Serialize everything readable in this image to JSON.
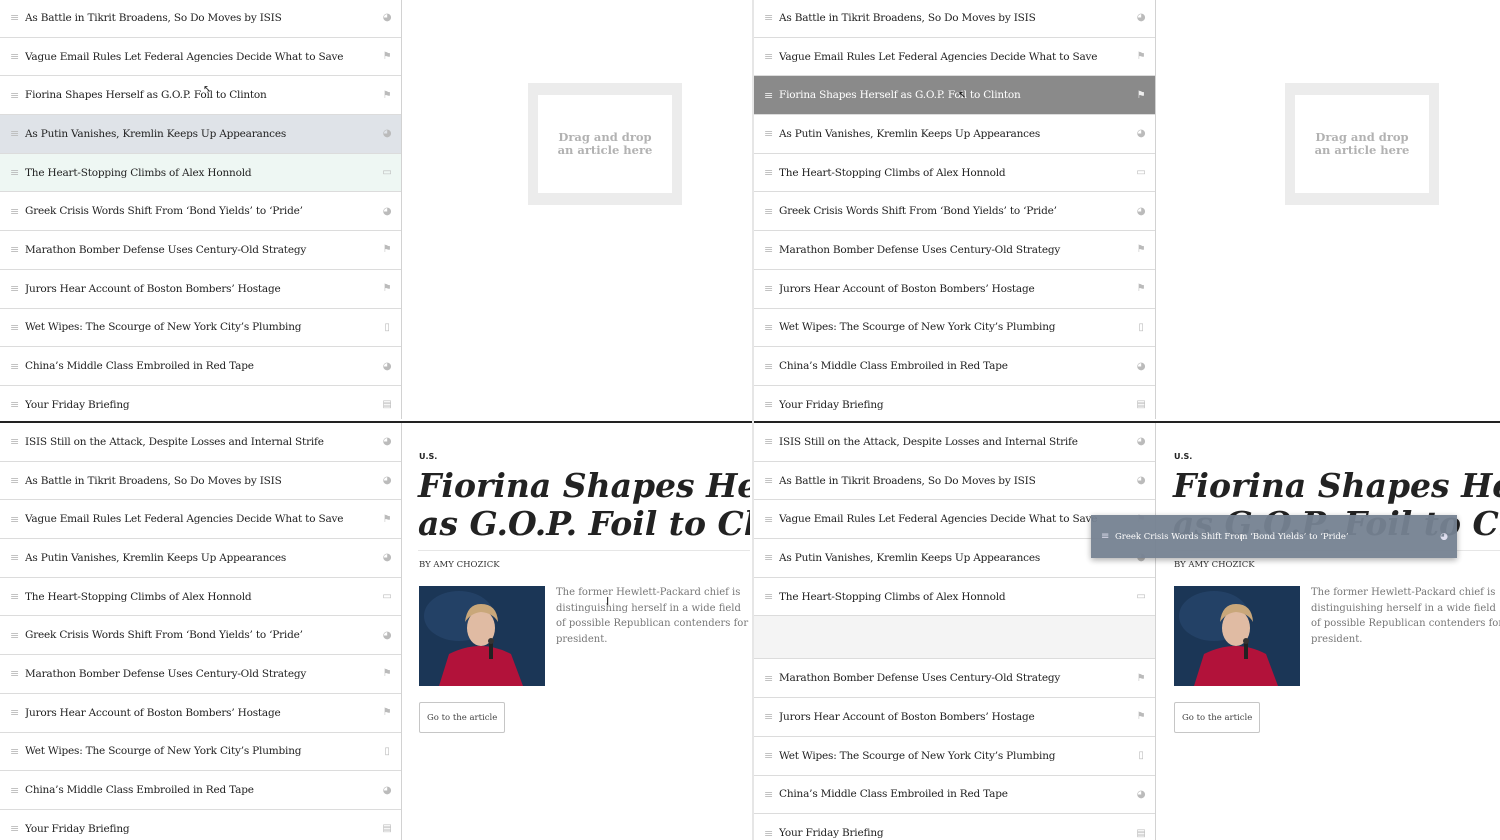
{
  "icons": {
    "grip": "≡",
    "world": "◕",
    "flag": "⚑",
    "photo": "▭",
    "phone": "▯",
    "calendar": "▤"
  },
  "panels": {
    "top_left": {
      "rows": [
        {
          "title": "As Battle in Tikrit Broadens, So Do Moves by ISIS",
          "icon": "world-icon",
          "glyph": "◕",
          "state": ""
        },
        {
          "title": "Vague Email Rules Let Federal Agencies Decide What to Save",
          "icon": "flag-icon",
          "glyph": "⚑",
          "state": ""
        },
        {
          "title": "Fiorina Shapes Herself as G.O.P. Foil to Clinton",
          "icon": "flag-icon",
          "glyph": "⚑",
          "state": ""
        },
        {
          "title": "As Putin Vanishes, Kremlin Keeps Up Appearances",
          "icon": "world-icon",
          "glyph": "◕",
          "state": "grey"
        },
        {
          "title": "The Heart-Stopping Climbs of Alex Honnold",
          "icon": "photo-icon",
          "glyph": "▭",
          "state": "mint"
        },
        {
          "title": "Greek Crisis Words Shift From ‘Bond Yields’ to ‘Pride’",
          "icon": "world-icon",
          "glyph": "◕",
          "state": ""
        },
        {
          "title": "Marathon Bomber Defense Uses Century-Old Strategy",
          "icon": "flag-icon",
          "glyph": "⚑",
          "state": ""
        },
        {
          "title": "Jurors Hear Account of Boston Bombers’ Hostage",
          "icon": "flag-icon",
          "glyph": "⚑",
          "state": ""
        },
        {
          "title": "Wet Wipes: The Scourge of New York City’s Plumbing",
          "icon": "phone-icon",
          "glyph": "▯",
          "state": ""
        },
        {
          "title": "China’s Middle Class Embroiled in Red Tape",
          "icon": "world-icon",
          "glyph": "◕",
          "state": ""
        },
        {
          "title": "Your Friday Briefing",
          "icon": "calendar-icon",
          "glyph": "▤",
          "state": ""
        }
      ],
      "dropzone": "Drag and drop an article here"
    },
    "top_right": {
      "rows": [
        {
          "title": "As Battle in Tikrit Broadens, So Do Moves by ISIS",
          "icon": "world-icon",
          "glyph": "◕",
          "state": ""
        },
        {
          "title": "Vague Email Rules Let Federal Agencies Decide What to Save",
          "icon": "flag-icon",
          "glyph": "⚑",
          "state": ""
        },
        {
          "title": "Fiorina Shapes Herself as G.O.P. Foil to Clinton",
          "icon": "flag-icon",
          "glyph": "⚑",
          "state": "dark"
        },
        {
          "title": "As Putin Vanishes, Kremlin Keeps Up Appearances",
          "icon": "world-icon",
          "glyph": "◕",
          "state": ""
        },
        {
          "title": "The Heart-Stopping Climbs of Alex Honnold",
          "icon": "photo-icon",
          "glyph": "▭",
          "state": ""
        },
        {
          "title": "Greek Crisis Words Shift From ‘Bond Yields’ to ‘Pride’",
          "icon": "world-icon",
          "glyph": "◕",
          "state": ""
        },
        {
          "title": "Marathon Bomber Defense Uses Century-Old Strategy",
          "icon": "flag-icon",
          "glyph": "⚑",
          "state": ""
        },
        {
          "title": "Jurors Hear Account of Boston Bombers’ Hostage",
          "icon": "flag-icon",
          "glyph": "⚑",
          "state": ""
        },
        {
          "title": "Wet Wipes: The Scourge of New York City’s Plumbing",
          "icon": "phone-icon",
          "glyph": "▯",
          "state": ""
        },
        {
          "title": "China’s Middle Class Embroiled in Red Tape",
          "icon": "world-icon",
          "glyph": "◕",
          "state": ""
        },
        {
          "title": "Your Friday Briefing",
          "icon": "calendar-icon",
          "glyph": "▤",
          "state": ""
        }
      ],
      "dropzone": "Drag and drop an article here"
    },
    "bottom_left": {
      "rows": [
        {
          "title": "ISIS Still on the Attack, Despite Losses and Internal Strife",
          "icon": "world-icon",
          "glyph": "◕",
          "state": ""
        },
        {
          "title": "As Battle in Tikrit Broadens, So Do Moves by ISIS",
          "icon": "world-icon",
          "glyph": "◕",
          "state": ""
        },
        {
          "title": "Vague Email Rules Let Federal Agencies Decide What to Save",
          "icon": "flag-icon",
          "glyph": "⚑",
          "state": ""
        },
        {
          "title": "As Putin Vanishes, Kremlin Keeps Up Appearances",
          "icon": "world-icon",
          "glyph": "◕",
          "state": ""
        },
        {
          "title": "The Heart-Stopping Climbs of Alex Honnold",
          "icon": "photo-icon",
          "glyph": "▭",
          "state": ""
        },
        {
          "title": "Greek Crisis Words Shift From ‘Bond Yields’ to ‘Pride’",
          "icon": "world-icon",
          "glyph": "◕",
          "state": ""
        },
        {
          "title": "Marathon Bomber Defense Uses Century-Old Strategy",
          "icon": "flag-icon",
          "glyph": "⚑",
          "state": ""
        },
        {
          "title": "Jurors Hear Account of Boston Bombers’ Hostage",
          "icon": "flag-icon",
          "glyph": "⚑",
          "state": ""
        },
        {
          "title": "Wet Wipes: The Scourge of New York City’s Plumbing",
          "icon": "phone-icon",
          "glyph": "▯",
          "state": ""
        },
        {
          "title": "China’s Middle Class Embroiled in Red Tape",
          "icon": "world-icon",
          "glyph": "◕",
          "state": ""
        },
        {
          "title": "Your Friday Briefing",
          "icon": "calendar-icon",
          "glyph": "▤",
          "state": ""
        }
      ]
    },
    "bottom_right": {
      "rows": [
        {
          "title": "ISIS Still on the Attack, Despite Losses and Internal Strife",
          "icon": "world-icon",
          "glyph": "◕",
          "state": ""
        },
        {
          "title": "As Battle in Tikrit Broadens, So Do Moves by ISIS",
          "icon": "world-icon",
          "glyph": "◕",
          "state": ""
        },
        {
          "title": "Vague Email Rules Let Federal Agencies Decide What to Save",
          "icon": "flag-icon",
          "glyph": "⚑",
          "state": ""
        },
        {
          "title": "As Putin Vanishes, Kremlin Keeps Up Appearances",
          "icon": "world-icon",
          "glyph": "◕",
          "state": ""
        },
        {
          "title": "The Heart-Stopping Climbs of Alex Honnold",
          "icon": "photo-icon",
          "glyph": "▭",
          "state": ""
        },
        {
          "title": "",
          "icon": "",
          "glyph": "",
          "state": "placeholder"
        },
        {
          "title": "Marathon Bomber Defense Uses Century-Old Strategy",
          "icon": "flag-icon",
          "glyph": "⚑",
          "state": ""
        },
        {
          "title": "Jurors Hear Account of Boston Bombers’ Hostage",
          "icon": "flag-icon",
          "glyph": "⚑",
          "state": ""
        },
        {
          "title": "Wet Wipes: The Scourge of New York City’s Plumbing",
          "icon": "phone-icon",
          "glyph": "▯",
          "state": ""
        },
        {
          "title": "China’s Middle Class Embroiled in Red Tape",
          "icon": "world-icon",
          "glyph": "◕",
          "state": ""
        },
        {
          "title": "Your Friday Briefing",
          "icon": "calendar-icon",
          "glyph": "▤",
          "state": ""
        }
      ],
      "drag_ghost": {
        "title": "Greek Crisis Words Shift From ‘Bond Yields’ to ‘Pride’",
        "glyph": "◕"
      }
    }
  },
  "article": {
    "kicker": "U.S.",
    "headline_line1": "Fiorina Shapes Herself",
    "headline_line2": "as G.O.P. Foil to Clinton",
    "byline": "BY AMY CHOZICK",
    "summary": "The former Hewlett-Packard chief is distinguishing herself in a wide field of possible Republican contenders for president.",
    "button": "Go to the article"
  },
  "colors": {
    "dark_row": "#8a8a8a",
    "drag_ghost": "#768292",
    "hover_row": "#dfe3e8",
    "mint_row": "#eef7f3"
  }
}
